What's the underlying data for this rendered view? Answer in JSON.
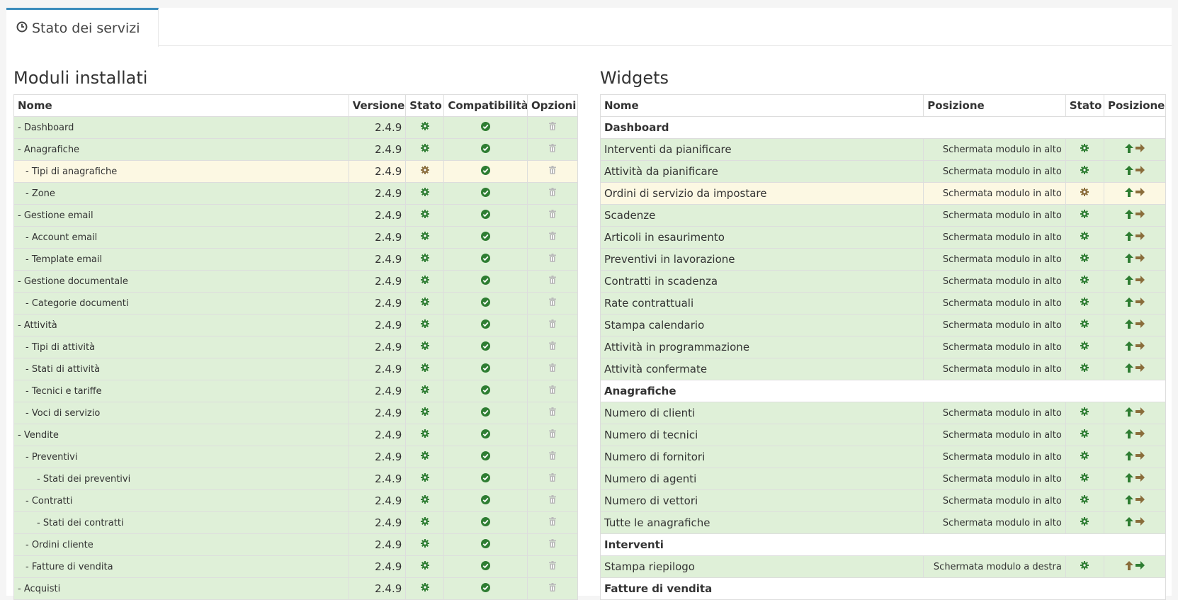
{
  "tab": {
    "label": "Stato dei servizi",
    "icon": "clock-icon"
  },
  "colors": {
    "ok_row": "#dff0d8",
    "warn_row": "#fcf8e3",
    "green": "#2e7d32",
    "brown": "#8a6d3b",
    "tab_accent": "#3c8dbc",
    "trash": "#bbbbbb"
  },
  "modules": {
    "title": "Moduli installati",
    "headers": {
      "name": "Nome",
      "version": "Versione",
      "state": "Stato",
      "compat": "Compatibilità",
      "options": "Opzioni"
    },
    "rows": [
      {
        "name": "- Dashboard",
        "level": 0,
        "version": "2.4.9",
        "state": "ok"
      },
      {
        "name": "- Anagrafiche",
        "level": 0,
        "version": "2.4.9",
        "state": "ok"
      },
      {
        "name": "- Tipi di anagrafiche",
        "level": 1,
        "version": "2.4.9",
        "state": "warn"
      },
      {
        "name": "- Zone",
        "level": 1,
        "version": "2.4.9",
        "state": "ok"
      },
      {
        "name": "- Gestione email",
        "level": 0,
        "version": "2.4.9",
        "state": "ok"
      },
      {
        "name": "- Account email",
        "level": 1,
        "version": "2.4.9",
        "state": "ok"
      },
      {
        "name": "- Template email",
        "level": 1,
        "version": "2.4.9",
        "state": "ok"
      },
      {
        "name": "- Gestione documentale",
        "level": 0,
        "version": "2.4.9",
        "state": "ok"
      },
      {
        "name": "- Categorie documenti",
        "level": 1,
        "version": "2.4.9",
        "state": "ok"
      },
      {
        "name": "- Attività",
        "level": 0,
        "version": "2.4.9",
        "state": "ok"
      },
      {
        "name": "- Tipi di attività",
        "level": 1,
        "version": "2.4.9",
        "state": "ok"
      },
      {
        "name": "- Stati di attività",
        "level": 1,
        "version": "2.4.9",
        "state": "ok"
      },
      {
        "name": "- Tecnici e tariffe",
        "level": 1,
        "version": "2.4.9",
        "state": "ok"
      },
      {
        "name": "- Voci di servizio",
        "level": 1,
        "version": "2.4.9",
        "state": "ok"
      },
      {
        "name": "- Vendite",
        "level": 0,
        "version": "2.4.9",
        "state": "ok"
      },
      {
        "name": "- Preventivi",
        "level": 1,
        "version": "2.4.9",
        "state": "ok"
      },
      {
        "name": "- Stati dei preventivi",
        "level": 2,
        "version": "2.4.9",
        "state": "ok"
      },
      {
        "name": "- Contratti",
        "level": 1,
        "version": "2.4.9",
        "state": "ok"
      },
      {
        "name": "- Stati dei contratti",
        "level": 2,
        "version": "2.4.9",
        "state": "ok"
      },
      {
        "name": "- Ordini cliente",
        "level": 1,
        "version": "2.4.9",
        "state": "ok"
      },
      {
        "name": "- Fatture di vendita",
        "level": 1,
        "version": "2.4.9",
        "state": "ok"
      },
      {
        "name": "- Acquisti",
        "level": 0,
        "version": "2.4.9",
        "state": "ok"
      }
    ]
  },
  "widgets": {
    "title": "Widgets",
    "headers": {
      "name": "Nome",
      "position": "Posizione",
      "state": "Stato",
      "position2": "Posizione"
    },
    "rows": [
      {
        "type": "group",
        "name": "Dashboard"
      },
      {
        "name": "Interventi da pianificare",
        "position": "Schermata modulo in alto",
        "state": "ok",
        "arrow": "up"
      },
      {
        "name": "Attività da pianificare",
        "position": "Schermata modulo in alto",
        "state": "ok",
        "arrow": "up"
      },
      {
        "name": "Ordini di servizio da impostare",
        "position": "Schermata modulo in alto",
        "state": "warn",
        "arrow": "up"
      },
      {
        "name": "Scadenze",
        "position": "Schermata modulo in alto",
        "state": "ok",
        "arrow": "up"
      },
      {
        "name": "Articoli in esaurimento",
        "position": "Schermata modulo in alto",
        "state": "ok",
        "arrow": "up"
      },
      {
        "name": "Preventivi in lavorazione",
        "position": "Schermata modulo in alto",
        "state": "ok",
        "arrow": "up"
      },
      {
        "name": "Contratti in scadenza",
        "position": "Schermata modulo in alto",
        "state": "ok",
        "arrow": "up"
      },
      {
        "name": "Rate contrattuali",
        "position": "Schermata modulo in alto",
        "state": "ok",
        "arrow": "up"
      },
      {
        "name": "Stampa calendario",
        "position": "Schermata modulo in alto",
        "state": "ok",
        "arrow": "up"
      },
      {
        "name": "Attività in programmazione",
        "position": "Schermata modulo in alto",
        "state": "ok",
        "arrow": "up"
      },
      {
        "name": "Attività confermate",
        "position": "Schermata modulo in alto",
        "state": "ok",
        "arrow": "up"
      },
      {
        "type": "group",
        "name": "Anagrafiche"
      },
      {
        "name": "Numero di clienti",
        "position": "Schermata modulo in alto",
        "state": "ok",
        "arrow": "up"
      },
      {
        "name": "Numero di tecnici",
        "position": "Schermata modulo in alto",
        "state": "ok",
        "arrow": "up"
      },
      {
        "name": "Numero di fornitori",
        "position": "Schermata modulo in alto",
        "state": "ok",
        "arrow": "up"
      },
      {
        "name": "Numero di agenti",
        "position": "Schermata modulo in alto",
        "state": "ok",
        "arrow": "up"
      },
      {
        "name": "Numero di vettori",
        "position": "Schermata modulo in alto",
        "state": "ok",
        "arrow": "up"
      },
      {
        "name": "Tutte le anagrafiche",
        "position": "Schermata modulo in alto",
        "state": "ok",
        "arrow": "up"
      },
      {
        "type": "group",
        "name": "Interventi"
      },
      {
        "name": "Stampa riepilogo",
        "position": "Schermata modulo a destra",
        "state": "ok",
        "arrow": "right"
      },
      {
        "type": "group",
        "name": "Fatture di vendita"
      }
    ]
  }
}
